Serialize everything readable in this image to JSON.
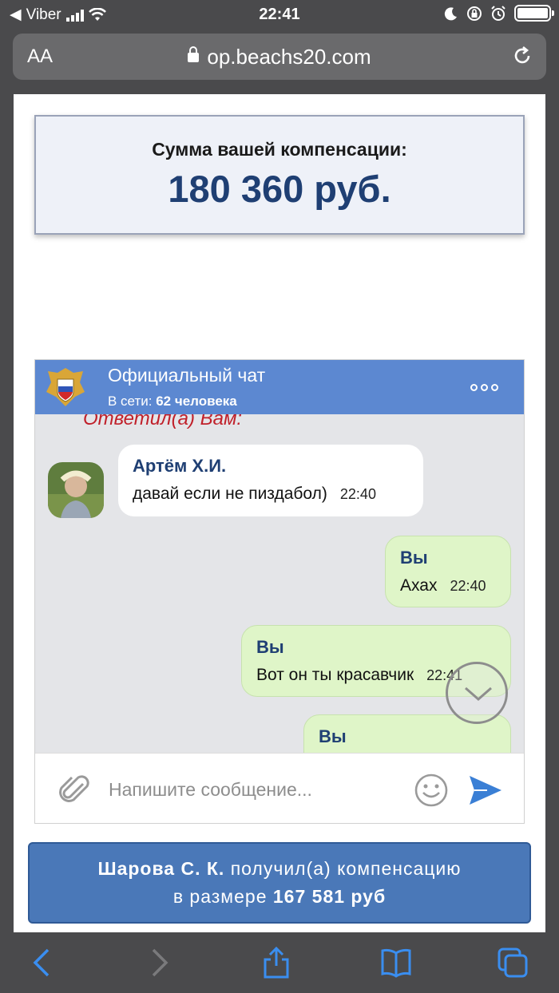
{
  "status_bar": {
    "carrier": "Viber",
    "time": "22:41"
  },
  "browser": {
    "aa_label": "AA",
    "url": "op.beachs20.com"
  },
  "compensation": {
    "label": "Сумма вашей компенсации:",
    "amount": "180 360 руб."
  },
  "chat": {
    "title": "Официальный чат",
    "online_prefix": "В сети:",
    "online_count": "62 человека",
    "replied_label": "Ответил(а) Вам:",
    "messages": [
      {
        "author": "Артём Х.И.",
        "text": "давай если не пиздабол)",
        "time": "22:40",
        "direction": "in"
      },
      {
        "author": "Вы",
        "text": "Ахах",
        "time": "22:40",
        "direction": "out"
      },
      {
        "author": "Вы",
        "text": "Вот он ты красавчик",
        "time": "22:41",
        "direction": "out"
      },
      {
        "author": "Вы",
        "text": "",
        "time": "",
        "direction": "out"
      }
    ],
    "input_placeholder": "Напишите сообщение..."
  },
  "notification": {
    "name": "Шарова С. К.",
    "text1": "получил(а) компенсацию",
    "text2": "в размере",
    "amount": "167 581 руб"
  },
  "colors": {
    "chat_header": "#5c88d1",
    "title_blue": "#1f3f73",
    "out_bubble": "#dff5c8",
    "notification": "#4a78b8",
    "replied_red": "#c0202a"
  }
}
